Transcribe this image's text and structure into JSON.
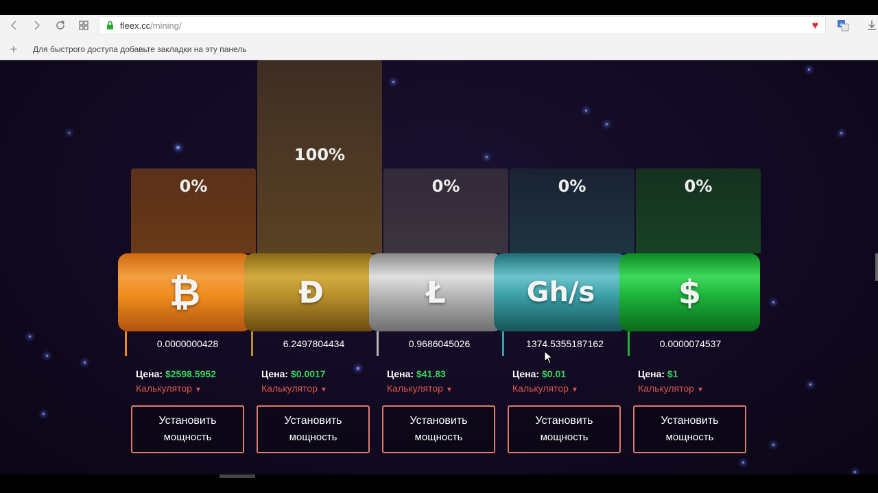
{
  "browser": {
    "url_host": "fleex.cc",
    "url_path": "/mining/",
    "bookmarks_hint": "Для быстрого доступа добавьте закладки на эту панель"
  },
  "towers": [
    {
      "percent": "0%",
      "level": 0.0
    },
    {
      "percent": "100%",
      "level": 1.0
    },
    {
      "percent": "0%",
      "level": 0.0
    },
    {
      "percent": "0%",
      "level": 0.0
    },
    {
      "percent": "0%",
      "level": 0.0
    }
  ],
  "currencies": [
    {
      "symbol": "₿",
      "value": "0.0000000428",
      "price_label": "Цена:",
      "price": "$2598.5952",
      "calc": "Калькулятор",
      "button_line1": "Установить",
      "button_line2": "мощность",
      "color": "#f08c1c"
    },
    {
      "symbol": "Ð",
      "value": "6.2497804434",
      "price_label": "Цена:",
      "price": "$0.0017",
      "calc": "Калькулятор",
      "button_line1": "Установить",
      "button_line2": "мощность",
      "color": "#b88f2a"
    },
    {
      "symbol": "Ł",
      "value": "0.9686045026",
      "price_label": "Цена:",
      "price": "$41.83",
      "calc": "Калькулятор",
      "button_line1": "Установить",
      "button_line2": "мощность",
      "color": "#b4b4b4"
    },
    {
      "symbol": "Gh/s",
      "value": "1374.5355187162",
      "price_label": "Цена:",
      "price": "$0.01",
      "calc": "Калькулятор",
      "button_line1": "Установить",
      "button_line2": "мощность",
      "color": "#3a9ea6"
    },
    {
      "symbol": "$",
      "value": "0.0000074537",
      "price_label": "Цена:",
      "price": "$1",
      "calc": "Калькулятор",
      "button_line1": "Установить",
      "button_line2": "мощность",
      "color": "#1db23a"
    }
  ],
  "colors": {
    "price_green": "#3ad05a",
    "calc_red": "#d9574a",
    "button_border": "#e07a6a"
  },
  "icons": [
    "back-icon",
    "forward-icon",
    "reload-icon",
    "apps-grid-icon",
    "lock-icon",
    "heart-icon",
    "translate-icon",
    "download-icon",
    "plus-icon"
  ]
}
